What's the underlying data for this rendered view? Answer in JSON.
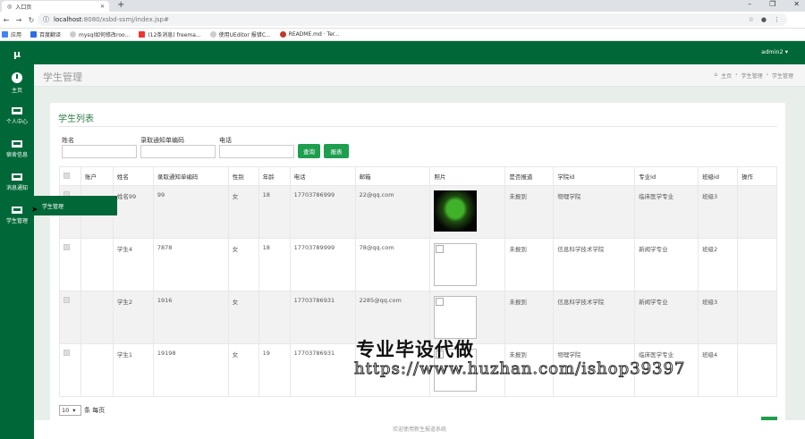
{
  "browser": {
    "tab_title": "入口页",
    "url_host": "localhost",
    "url_path": ":8080/xsbd-ssmj/index.jsp#",
    "bookmarks": [
      "应用",
      "百度翻译",
      "mysql如何修改roo...",
      "(12条消息) freema...",
      "使用UEditor 报错C...",
      "README.md · Ter..."
    ]
  },
  "sidebar": {
    "logo": "μ",
    "items": [
      {
        "label": "主页",
        "icon": "dashboard-icon"
      },
      {
        "label": "个人中心",
        "icon": "monitor-icon"
      },
      {
        "label": "宿舍信息",
        "icon": "monitor-icon"
      },
      {
        "label": "消息通知",
        "icon": "monitor-icon"
      },
      {
        "label": "学生管理",
        "icon": "monitor-icon"
      }
    ],
    "flyout": "学生管理"
  },
  "header": {
    "user": "admin2 ▾"
  },
  "pagehead": {
    "title": "学生管理",
    "crumb_home": "主页",
    "crumb_1": "学生管理",
    "crumb_2": "学生管理"
  },
  "panel": {
    "title": "学生列表",
    "filters": {
      "name_label": "姓名",
      "notice_label": "录取通知单编码",
      "phone_label": "电话"
    },
    "search_btn": "查询",
    "report_btn": "报表"
  },
  "table": {
    "headers": [
      "",
      "账户",
      "姓名",
      "录取通知单编码",
      "性别",
      "年龄",
      "电话",
      "邮箱",
      "照片",
      "是否报道",
      "学院id",
      "专业id",
      "班级id",
      "操作"
    ],
    "rows": [
      {
        "account": "",
        "name": "姓名99",
        "notice": "99",
        "gender": "女",
        "age": "18",
        "phone": "17703786999",
        "email": "22@qq.com",
        "photo": "frog",
        "reported": "未报到",
        "college": "物理学院",
        "major": "临床医学专业",
        "class": "班级3",
        "op": ""
      },
      {
        "account": "",
        "name": "学生4",
        "notice": "7878",
        "gender": "女",
        "age": "18",
        "phone": "17703789999",
        "email": "78@qq.com",
        "photo": "broken",
        "reported": "未报到",
        "college": "信息科学技术学院",
        "major": "新闻学专业",
        "class": "班级2",
        "op": ""
      },
      {
        "account": "",
        "name": "学生2",
        "notice": "1916",
        "gender": "女",
        "age": "",
        "phone": "17703786931",
        "email": "2285@qq.com",
        "photo": "broken",
        "reported": "未报到",
        "college": "信息科学技术学院",
        "major": "新闻学专业",
        "class": "班级3",
        "op": ""
      },
      {
        "account": "",
        "name": "学生1",
        "notice": "19198",
        "gender": "女",
        "age": "19",
        "phone": "17703786931",
        "email": "",
        "photo": "broken",
        "reported": "未报到",
        "college": "物理学院",
        "major": "临床医学专业",
        "class": "班级4",
        "op": ""
      }
    ]
  },
  "pager": {
    "page_size": "10",
    "suffix": "条 每页"
  },
  "footer": "欢迎使用新生报道系统",
  "watermark": {
    "line1": "专业毕设代做",
    "line2": "https://www.huzhan.com/ishop39397"
  }
}
